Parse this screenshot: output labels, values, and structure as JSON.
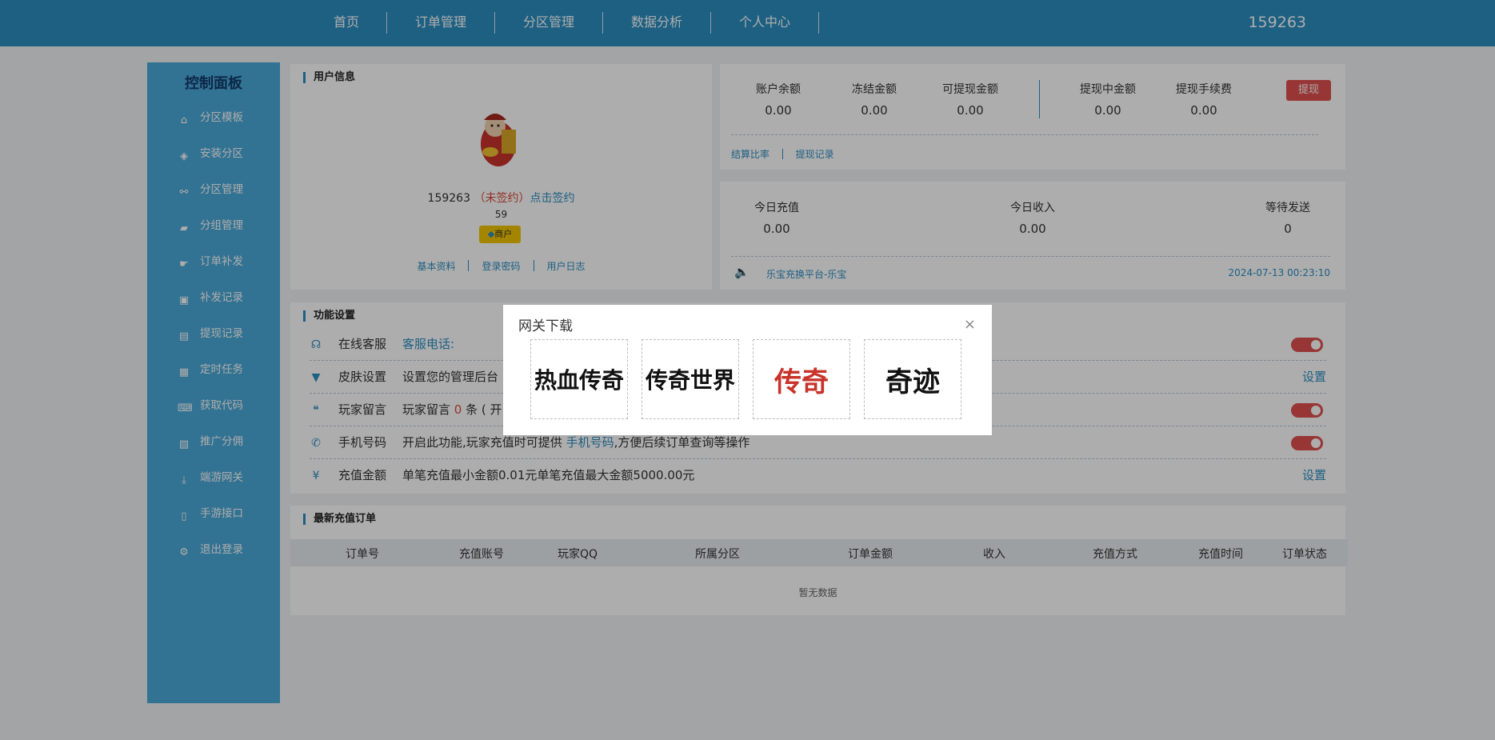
{
  "nav": {
    "items": [
      "首页",
      "订单管理",
      "分区管理",
      "数据分析",
      "个人中心"
    ],
    "user_id": "159263"
  },
  "sidebar": {
    "title": "控制面板",
    "items": [
      {
        "label": "分区模板",
        "icon": "home-icon"
      },
      {
        "label": "安装分区",
        "icon": "cube-icon"
      },
      {
        "label": "分区管理",
        "icon": "sitemap-icon"
      },
      {
        "label": "分组管理",
        "icon": "truck-icon"
      },
      {
        "label": "订单补发",
        "icon": "hand-icon"
      },
      {
        "label": "补发记录",
        "icon": "archive-icon"
      },
      {
        "label": "提现记录",
        "icon": "wallet-icon"
      },
      {
        "label": "定时任务",
        "icon": "calendar-icon"
      },
      {
        "label": "获取代码",
        "icon": "code-icon"
      },
      {
        "label": "推广分佣",
        "icon": "share-icon"
      },
      {
        "label": "端游网关",
        "icon": "download-icon"
      },
      {
        "label": "手游接口",
        "icon": "mobile-icon"
      },
      {
        "label": "退出登录",
        "icon": "gear-icon"
      }
    ]
  },
  "user_info": {
    "title": "用户信息",
    "uid": "159263",
    "sign_status": "（未签约）",
    "sign_link": "点击签约",
    "level": "59",
    "badge": "商户",
    "links": [
      "基本资料",
      "登录密码",
      "用户日志"
    ]
  },
  "balance": {
    "items": [
      {
        "label": "账户余额",
        "value": "0.00"
      },
      {
        "label": "冻结金额",
        "value": "0.00"
      },
      {
        "label": "可提现金额",
        "value": "0.00"
      },
      {
        "label": "提现中金额",
        "value": "0.00"
      },
      {
        "label": "提现手续费",
        "value": "0.00"
      }
    ],
    "withdraw_button": "提现",
    "links": [
      "结算比率",
      "提现记录"
    ]
  },
  "today": {
    "items": [
      {
        "label": "今日充值",
        "value": "0.00"
      },
      {
        "label": "今日收入",
        "value": "0.00"
      },
      {
        "label": "等待发送",
        "value": "0"
      }
    ],
    "notice": "乐宝充换平台-乐宝",
    "time": "2024-07-13 00:23:10"
  },
  "functions": {
    "title": "功能设置",
    "rows": [
      {
        "name": "在线客服",
        "desc": "客服电话:",
        "control": "toggle"
      },
      {
        "name": "皮肤设置",
        "desc": "设置您的管理后台",
        "control": "设置"
      },
      {
        "name": "玩家留言",
        "desc_a": "玩家留言",
        "count": "0",
        "desc_b": "条 ( 开",
        "control": "toggle"
      },
      {
        "name": "手机号码",
        "desc_a": "开启此功能,玩家充值时可提供",
        "highlight": "手机号码",
        "desc_b": ",方便后续订单查询等操作",
        "control": "toggle"
      },
      {
        "name": "充值金额",
        "desc": "单笔充值最小金额0.01元单笔充值最大金额5000.00元",
        "control": "设置"
      }
    ]
  },
  "orders": {
    "title": "最新充值订单",
    "columns": [
      "订单号",
      "充值账号",
      "玩家QQ",
      "所属分区",
      "订单金额",
      "收入",
      "充值方式",
      "充值时间",
      "订单状态"
    ],
    "empty": "暂无数据"
  },
  "modal": {
    "title": "网关下载",
    "close": "×",
    "logos": [
      "热血传奇",
      "传奇世界",
      "传奇",
      "奇迹"
    ]
  }
}
